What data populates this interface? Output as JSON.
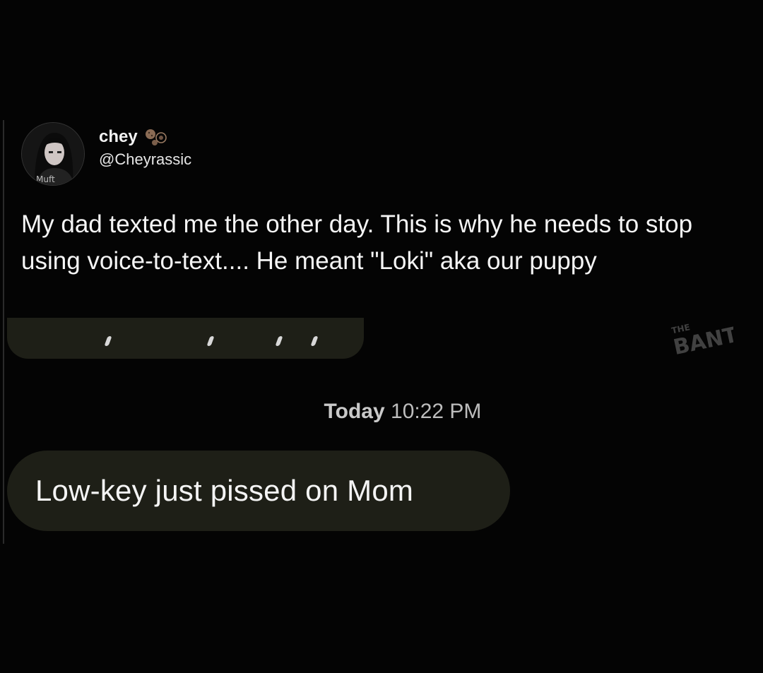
{
  "tweet": {
    "display_name": "chey",
    "handle": "@Cheyrassic",
    "text": "My dad texted me the other day. This is why he needs to stop using voice-to-text.... He meant \"Loki\" aka our puppy",
    "badge_icon": "cookie-emoji-icon",
    "avatar_icon": "avatar-photo-icon"
  },
  "conversation": {
    "timestamp_day": "Today",
    "timestamp_time": "10:22 PM",
    "message": "Low-key just pissed on Mom"
  },
  "watermark": {
    "text": "THE BANTZ"
  },
  "colors": {
    "background": "#040404",
    "bubble": "#1e1f17",
    "text": "#f5f5f5",
    "timestamp": "#bdbdbd"
  }
}
